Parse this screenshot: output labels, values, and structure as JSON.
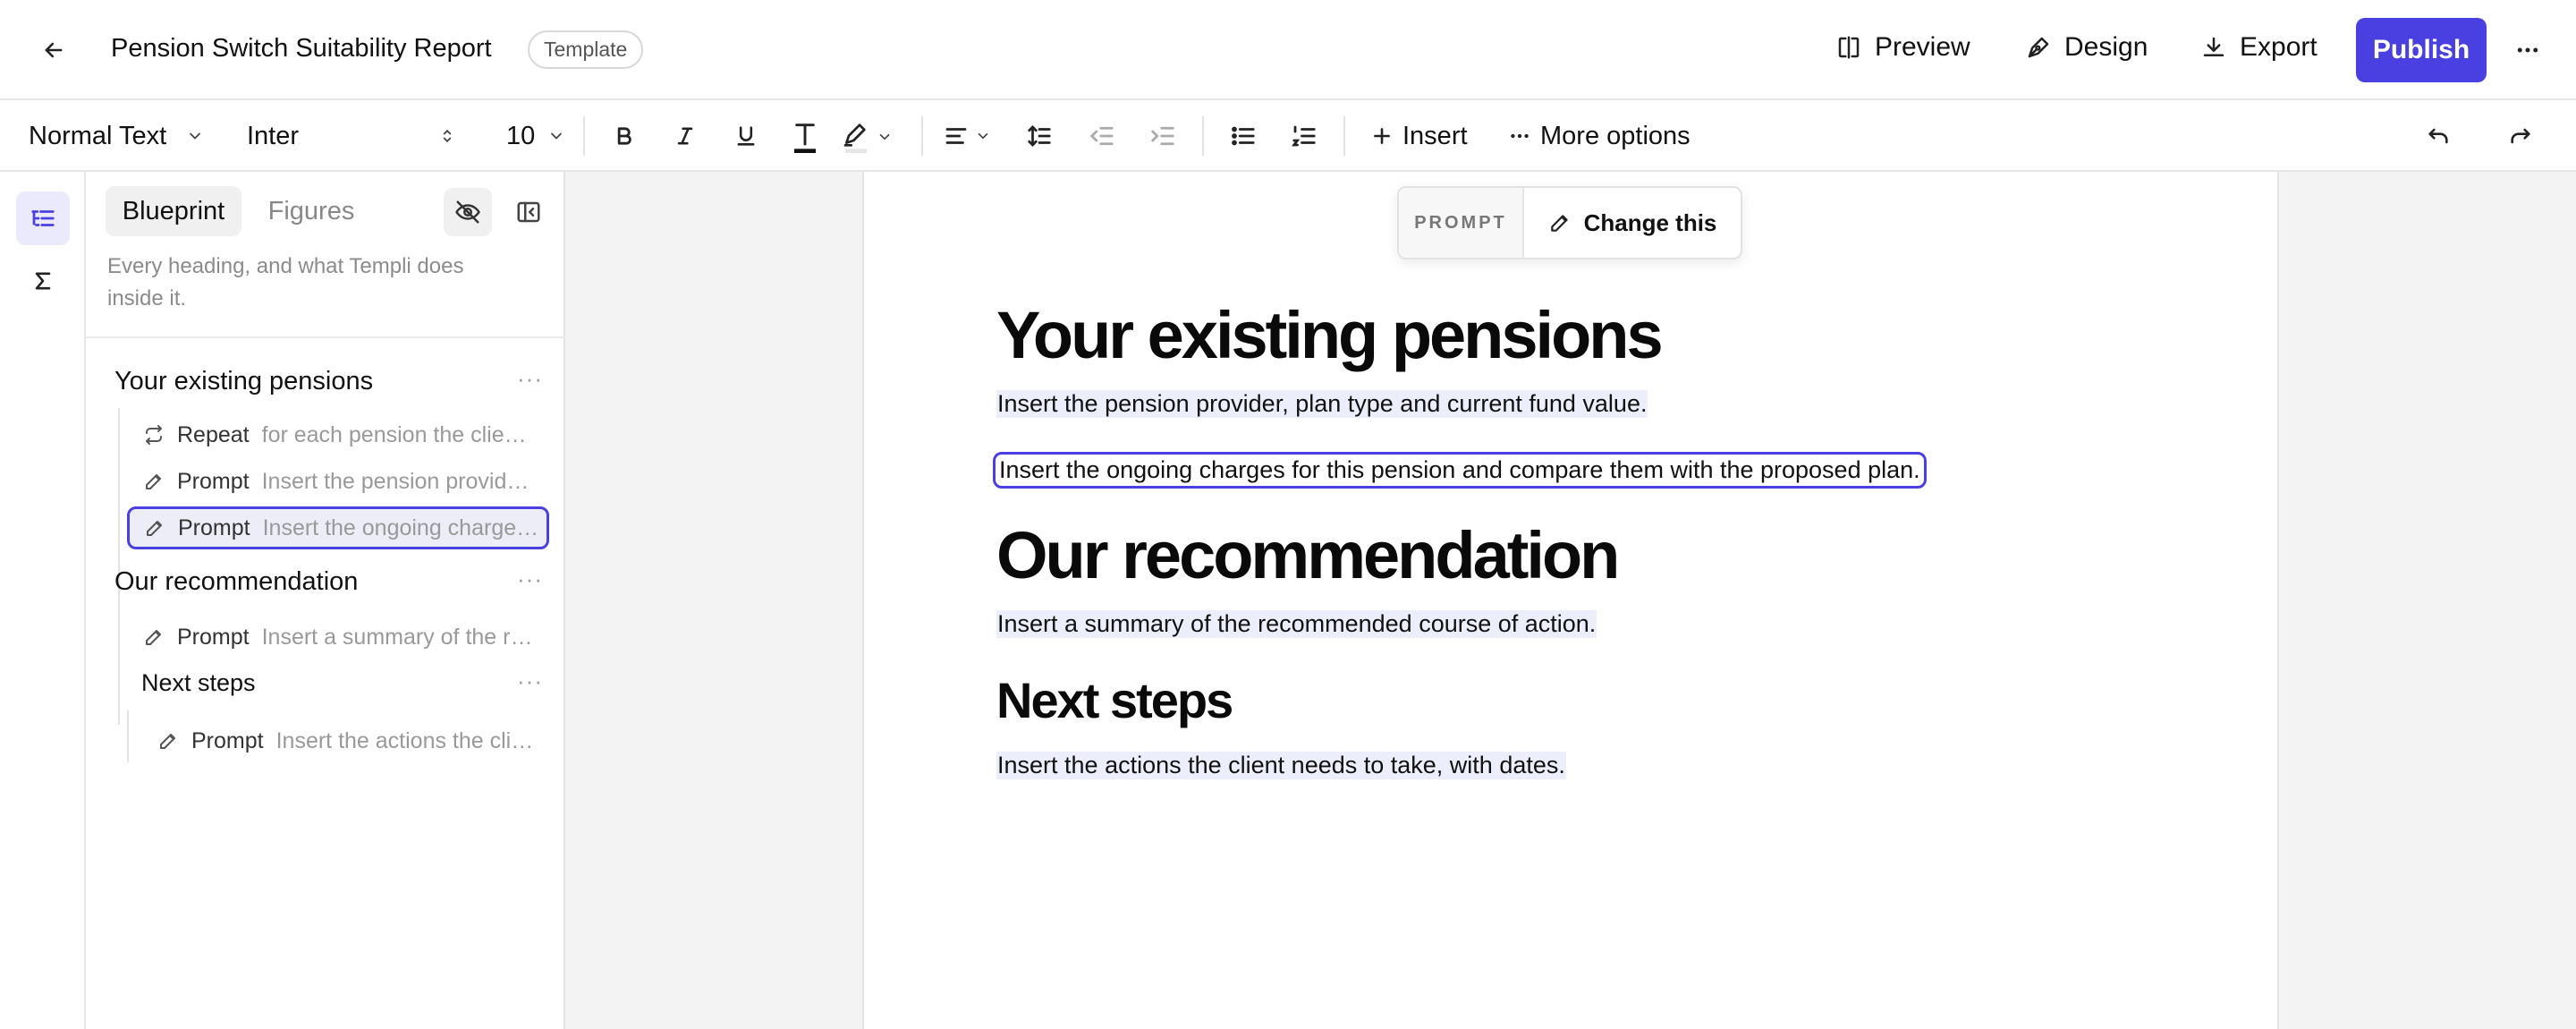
{
  "header": {
    "title": "Pension Switch Suitability Report",
    "badge": "Template",
    "preview_label": "Preview",
    "design_label": "Design",
    "export_label": "Export",
    "publish_label": "Publish"
  },
  "toolbar": {
    "style_select": "Normal Text",
    "font_select": "Inter",
    "size_select": "10",
    "insert_label": "Insert",
    "more_label": "More options"
  },
  "panel": {
    "tabs": [
      {
        "label": "Blueprint",
        "active": true
      },
      {
        "label": "Figures",
        "active": false
      }
    ],
    "description": "Every heading, and what Templi does inside it.",
    "sections": [
      {
        "heading": "Your existing pensions",
        "items": [
          {
            "kind": "Repeat",
            "detail": "for each pension the client holds",
            "icon": "repeat-icon"
          },
          {
            "kind": "Prompt",
            "detail": "Insert the pension provider, plan type and current fund value.",
            "icon": "pencil-icon"
          },
          {
            "kind": "Prompt",
            "detail": "Insert the ongoing charges for this pension and compare them with the proposed plan.",
            "icon": "pencil-icon",
            "selected": true
          }
        ]
      },
      {
        "heading": "Our recommendation",
        "items": [
          {
            "kind": "Prompt",
            "detail": "Insert a summary of the recommended course of action.",
            "icon": "pencil-icon"
          }
        ],
        "subsection": {
          "heading": "Next steps",
          "items": [
            {
              "kind": "Prompt",
              "detail": "Insert the actions the client needs to take, with dates.",
              "icon": "pencil-icon"
            }
          ]
        }
      }
    ]
  },
  "popup": {
    "label": "PROMPT",
    "action": "Change this"
  },
  "document": {
    "h1_existing": "Your existing pensions",
    "p_provider": "Insert the pension provider, plan type and current fund value.",
    "p_charges": "Insert the ongoing charges for this pension and compare them with the proposed plan.",
    "h1_recommendation": "Our recommendation",
    "p_summary": "Insert a summary of the recommended course of action.",
    "h2_next": "Next steps",
    "p_actions": "Insert the actions the client needs to take, with dates."
  },
  "colors": {
    "accent": "#4a3fe0",
    "prompt_highlight": "#eceefc",
    "canvas": "#f3f3f3"
  }
}
